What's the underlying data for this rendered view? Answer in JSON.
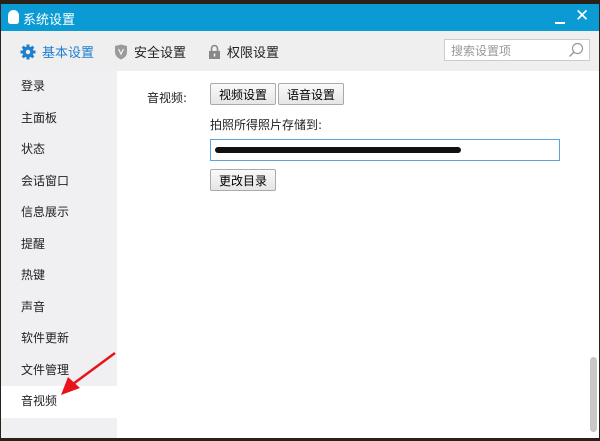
{
  "window": {
    "title": "系统设置",
    "minimize_icon": "minimize-icon",
    "close_icon": "close-icon",
    "close_glyph": "✕"
  },
  "toolbar": {
    "tabs": [
      {
        "label": "基本设置",
        "icon": "gear-icon",
        "active": true
      },
      {
        "label": "安全设置",
        "icon": "shield-icon",
        "active": false
      },
      {
        "label": "权限设置",
        "icon": "lock-icon",
        "active": false
      }
    ],
    "search_placeholder": "搜索设置项",
    "accent": "#1e7fd0"
  },
  "sidebar": {
    "items": [
      "登录",
      "主面板",
      "状态",
      "会话窗口",
      "信息展示",
      "提醒",
      "热键",
      "声音",
      "软件更新",
      "文件管理",
      "音视频"
    ],
    "selected": "音视频"
  },
  "content": {
    "section_label": "音视频:",
    "video_settings": "视频设置",
    "voice_settings": "语音设置",
    "photo_path_label": "拍照所得照片存储到:",
    "change_dir": "更改目录"
  },
  "colors": {
    "titlebar": "#0b9bd4",
    "annotation_arrow": "#e8141b"
  }
}
